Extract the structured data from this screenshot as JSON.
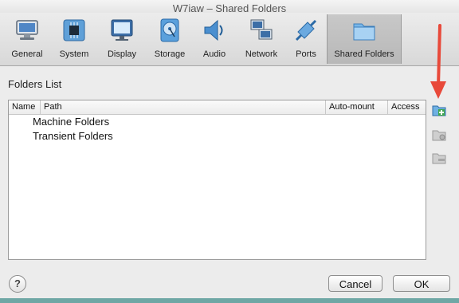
{
  "window": {
    "title": "W7iaw – Shared Folders"
  },
  "toolbar": {
    "items": [
      {
        "label": "General",
        "icon": "monitor-icon"
      },
      {
        "label": "System",
        "icon": "chip-icon"
      },
      {
        "label": "Display",
        "icon": "display-icon"
      },
      {
        "label": "Storage",
        "icon": "disk-icon"
      },
      {
        "label": "Audio",
        "icon": "speaker-icon"
      },
      {
        "label": "Network",
        "icon": "network-icon"
      },
      {
        "label": "Ports",
        "icon": "port-icon"
      },
      {
        "label": "Shared Folders",
        "icon": "folder-icon",
        "active": true
      }
    ]
  },
  "folders": {
    "section_title": "Folders List",
    "columns": [
      "Name",
      "Path",
      "Auto-mount",
      "Access"
    ],
    "rows": [
      "Machine Folders",
      "Transient Folders"
    ]
  },
  "side_buttons": [
    "add-folder-icon",
    "edit-folder-icon",
    "remove-folder-icon"
  ],
  "footer": {
    "help": "?",
    "cancel": "Cancel",
    "ok": "OK"
  },
  "colors": {
    "accent_arrow": "#e8493a",
    "active_tab": "#bdbdbd"
  }
}
